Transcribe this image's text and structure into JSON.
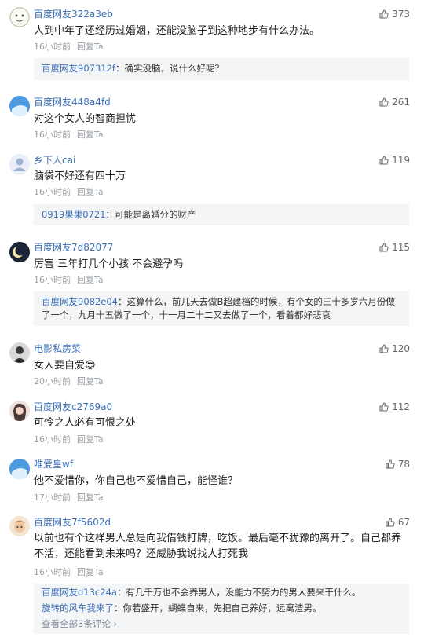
{
  "comments": [
    {
      "user": "百度网友322a3eb",
      "likes": "373",
      "text": "人到中年了还经历过婚姻，还能没脑子到这种地步有什么办法。",
      "time": "16小时前",
      "reply": "回复Ta",
      "sub": [
        {
          "name": "百度网友907312f",
          "text": "：确实没脑，说什么好呢？"
        }
      ]
    },
    {
      "user": "百度网友448a4fd",
      "likes": "261",
      "text": "对这个女人的智商担忧",
      "time": "16小时前",
      "reply": "回复Ta",
      "sub": []
    },
    {
      "user": "乡下人cai",
      "likes": "119",
      "text": "脑袋不好还有四十万",
      "time": "16小时前",
      "reply": "回复Ta",
      "sub": [
        {
          "name": "0919果果0721",
          "text": "：可能是离婚分的财产"
        }
      ]
    },
    {
      "user": "百度网友7d82077",
      "likes": "115",
      "text": "厉害 三年打几个小孩 不会避孕吗",
      "time": "16小时前",
      "reply": "回复Ta",
      "sub": [
        {
          "name": "百度网友9082e04",
          "text": "：这算什么，前几天去做B超建档的时候，有个女的三十多岁六月份做了一个，九月十五做了一个，十一月二十二又去做了一个，看着都好悲哀"
        }
      ]
    },
    {
      "user": "电影私房菜",
      "likes": "120",
      "text": "女人要自爱😍",
      "time": "20小时前",
      "reply": "回复Ta",
      "sub": []
    },
    {
      "user": "百度网友c2769a0",
      "likes": "112",
      "text": "可怜之人必有可恨之处",
      "time": "16小时前",
      "reply": "回复Ta",
      "sub": []
    },
    {
      "user": "唯爱皇wf",
      "likes": "78",
      "text": "他不爱惜你，你自己也不爱惜自己，能怪谁？",
      "time": "17小时前",
      "reply": "回复Ta",
      "sub": []
    },
    {
      "user": "百度网友7f5602d",
      "likes": "67",
      "text": "以前也有个这样男人总是向我借钱打牌，吃饭。最后毫不犹豫的离开了。自己都养不活，还能看到未来吗？还威胁我说找人打死我",
      "time": "16小时前",
      "reply": "回复Ta",
      "sub": [
        {
          "name": "百度网友d13c24a",
          "text": "：有几千万也不会养男人，没能力不努力的男人要来干什么。"
        },
        {
          "name": "旋转的风车我来了",
          "text": "：你若盛开，蝴蝶自来，先把自己养好，远离渣男。"
        }
      ],
      "more": "查看全部3条评论 ›"
    }
  ],
  "colors": {
    "username": "#3a6fb7",
    "meta": "#9aa0a6",
    "reply_bg": "#f4f5f7"
  }
}
